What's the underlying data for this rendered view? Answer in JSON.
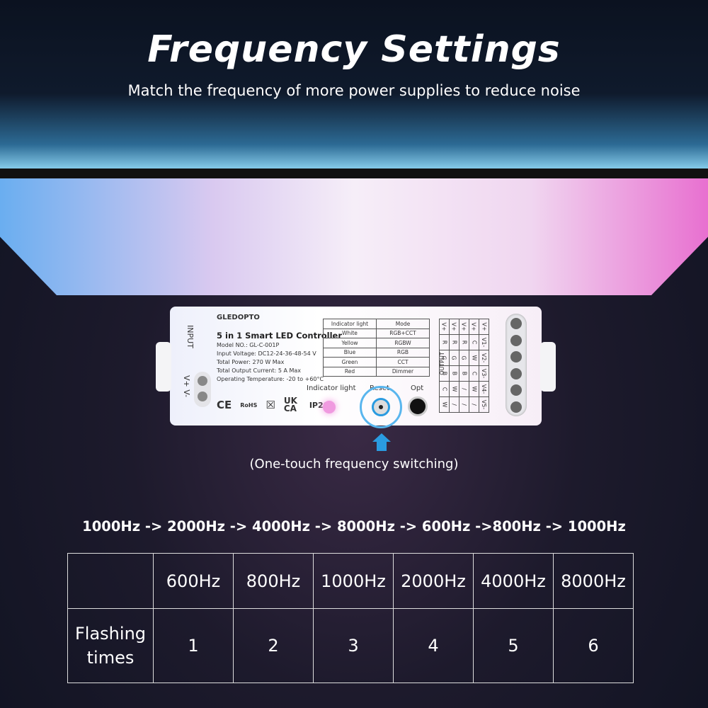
{
  "header": {
    "title": "Frequency Settings",
    "subtitle": "Match the frequency of more power supplies to reduce noise"
  },
  "device": {
    "brand": "GLEDOPTO",
    "product": "5 in 1 Smart LED Controller",
    "specs": [
      "Model NO.: GL-C-001P",
      "Input Voltage: DC12-24-36-48-54 V",
      "Total Power: 270 W Max",
      "Total Output Current: 5 A Max",
      "Operating Temperature: -20 to +60°C"
    ],
    "input_label": "INPUT",
    "input_terminals": "V+ V-",
    "output_label": "OUTPUT",
    "mode_table": {
      "headers": [
        "Indicator light",
        "Mode"
      ],
      "rows": [
        [
          "White",
          "RGB+CCT"
        ],
        [
          "Yellow",
          "RGBW"
        ],
        [
          "Blue",
          "RGB"
        ],
        [
          "Green",
          "CCT"
        ],
        [
          "Red",
          "Dimmer"
        ]
      ]
    },
    "output_table": [
      [
        "V+",
        "R",
        "G",
        "B",
        "C",
        "W"
      ],
      [
        "V+",
        "R",
        "G",
        "B",
        "W",
        "/"
      ],
      [
        "V+",
        "R",
        "G",
        "B",
        "/",
        "/"
      ],
      [
        "V+",
        "C",
        "W",
        "C",
        "W",
        "/"
      ],
      [
        "V+",
        "V1-",
        "V2-",
        "V3-",
        "V4-",
        "V5-"
      ]
    ],
    "certs": [
      "CE",
      "RoHS",
      "UK CA",
      "IP20"
    ],
    "indicator_label": "Indicator light",
    "reset_label": "Reset",
    "opt_label": "Opt",
    "indicator_color": "#f09ae0",
    "accent": "#2a9be0"
  },
  "caption": "(One-touch frequency switching)",
  "sequence": "1000Hz -> 2000Hz -> 4000Hz -> 8000Hz -> 600Hz ->800Hz -> 1000Hz",
  "freq_table": {
    "headers": [
      "",
      "600Hz",
      "800Hz",
      "1000Hz",
      "2000Hz",
      "4000Hz",
      "8000Hz"
    ],
    "row_label": "Flashing times",
    "values": [
      "1",
      "2",
      "3",
      "4",
      "5",
      "6"
    ]
  }
}
